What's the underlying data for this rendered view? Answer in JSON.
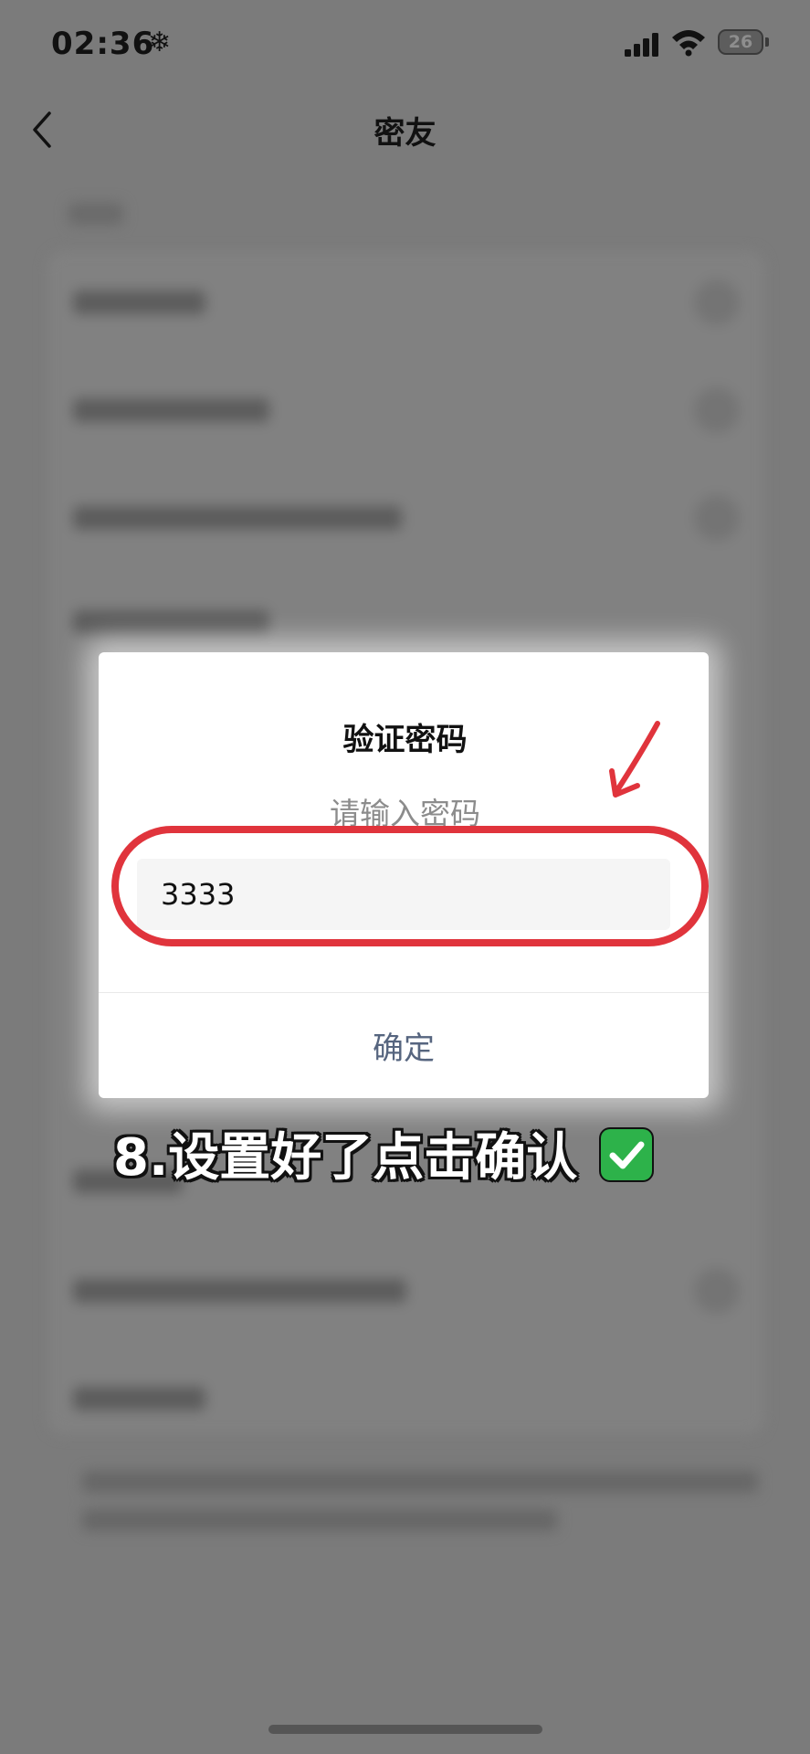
{
  "status_bar": {
    "time": "02:36",
    "weather_glyph": "❄",
    "battery_level": "26",
    "icons": [
      "snowflake-icon",
      "cellular-signal-icon",
      "wifi-icon",
      "battery-icon"
    ]
  },
  "nav": {
    "title": "密友",
    "back_icon": "chevron-left-icon"
  },
  "dialog": {
    "title": "验证密码",
    "subtitle": "请输入密码",
    "input_value": "3333",
    "confirm_label": "确定"
  },
  "annotation": {
    "caption": "8.设置好了点击确认",
    "caption_icon": "check-mark-button-emoji",
    "highlight_color": "#e0343c",
    "check_color": "#2db24a"
  },
  "colors": {
    "overlay": "#7b7b7b",
    "dialog_bg": "#ffffff",
    "confirm_text": "#56657f",
    "subtitle_text": "#8c8c8c"
  }
}
